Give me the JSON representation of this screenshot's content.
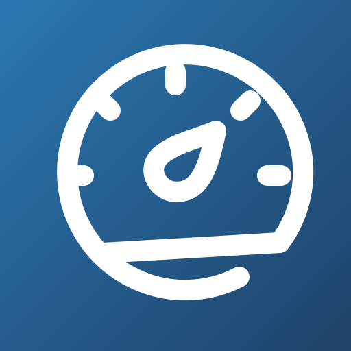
{
  "icon": {
    "semantic": "speedometer-icon",
    "background_gradient": {
      "start": "#2a78b2",
      "end": "#1f4268"
    },
    "foreground": "#ffffff"
  }
}
